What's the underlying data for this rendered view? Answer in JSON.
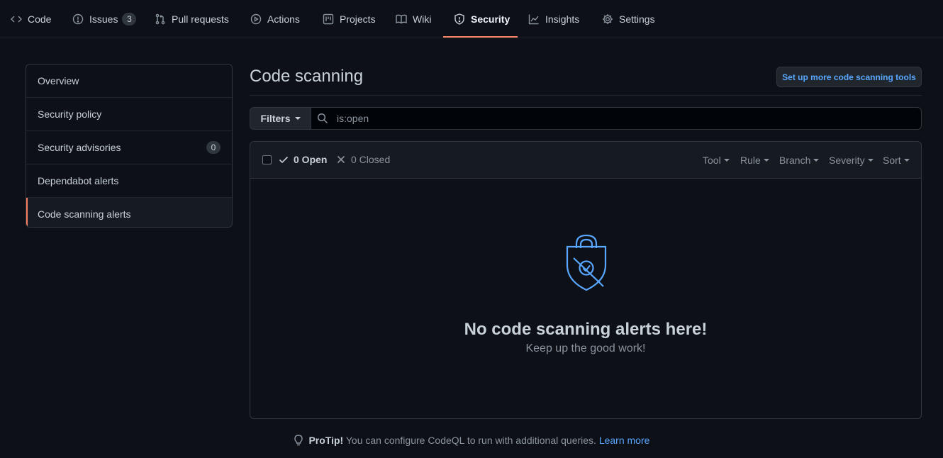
{
  "nav": {
    "tabs": [
      {
        "label": "Code"
      },
      {
        "label": "Issues",
        "count": "3"
      },
      {
        "label": "Pull requests"
      },
      {
        "label": "Actions"
      },
      {
        "label": "Projects"
      },
      {
        "label": "Wiki"
      },
      {
        "label": "Security"
      },
      {
        "label": "Insights"
      },
      {
        "label": "Settings"
      }
    ],
    "selected": "Security"
  },
  "sidebar": {
    "items": [
      {
        "label": "Overview"
      },
      {
        "label": "Security policy"
      },
      {
        "label": "Security advisories",
        "count": "0"
      },
      {
        "label": "Dependabot alerts"
      },
      {
        "label": "Code scanning alerts"
      }
    ],
    "active": "Code scanning alerts"
  },
  "main": {
    "title": "Code scanning",
    "setup_button": "Set up more code scanning tools",
    "filters_label": "Filters",
    "search_value": "is:open",
    "open_label": "0 Open",
    "closed_label": "0 Closed",
    "selectors": [
      "Tool",
      "Rule",
      "Branch",
      "Severity",
      "Sort"
    ],
    "blank_title": "No code scanning alerts here!",
    "blank_subtitle": "Keep up the good work!"
  },
  "protip": {
    "label": "ProTip!",
    "text": " You can configure CodeQL to run with additional queries. ",
    "link": "Learn more"
  },
  "colors": {
    "background": "#0d1117",
    "accent_underline": "#f78166",
    "link": "#58a6ff",
    "shield": "#58a6ff"
  }
}
